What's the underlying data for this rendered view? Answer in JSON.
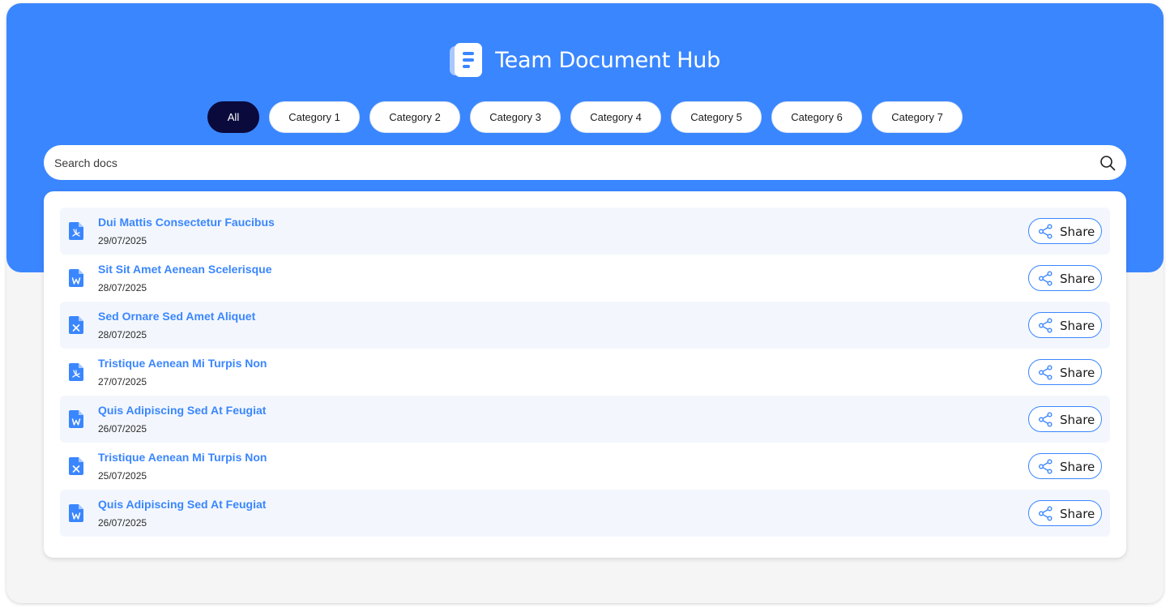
{
  "header": {
    "title": "Team Document Hub",
    "logo_icon": "document-icon"
  },
  "filters": {
    "active": "All",
    "items": [
      "All",
      "Category 1",
      "Category 2",
      "Category 3",
      "Category 4",
      "Category 5",
      "Category 6",
      "Category 7"
    ]
  },
  "search": {
    "placeholder": "Search docs",
    "value": "",
    "icon": "search-icon"
  },
  "documents": [
    {
      "title": "Dui Mattis Consectetur Faucibus",
      "date": "29/07/2025",
      "type": "pdf",
      "icon": "pdf-file-icon",
      "share_label": "Share"
    },
    {
      "title": "Sit Sit Amet Aenean Scelerisque",
      "date": "28/07/2025",
      "type": "word",
      "icon": "word-file-icon",
      "share_label": "Share"
    },
    {
      "title": "Sed Ornare Sed Amet Aliquet",
      "date": "28/07/2025",
      "type": "excel",
      "icon": "excel-file-icon",
      "share_label": "Share"
    },
    {
      "title": "Tristique Aenean Mi Turpis Non",
      "date": "27/07/2025",
      "type": "pdf",
      "icon": "pdf-file-icon",
      "share_label": "Share"
    },
    {
      "title": "Quis Adipiscing Sed At Feugiat",
      "date": "26/07/2025",
      "type": "word",
      "icon": "word-file-icon",
      "share_label": "Share"
    },
    {
      "title": "Tristique Aenean Mi Turpis Non",
      "date": "25/07/2025",
      "type": "excel",
      "icon": "excel-file-icon",
      "share_label": "Share"
    },
    {
      "title": "Quis Adipiscing Sed At Feugiat",
      "date": "26/07/2025",
      "type": "word",
      "icon": "word-file-icon",
      "share_label": "Share"
    }
  ],
  "colors": {
    "brand": "#3a86ff",
    "active_chip": "#0a0a3c",
    "row_shade": "#f3f7fd",
    "background": "#f5f5f5"
  }
}
